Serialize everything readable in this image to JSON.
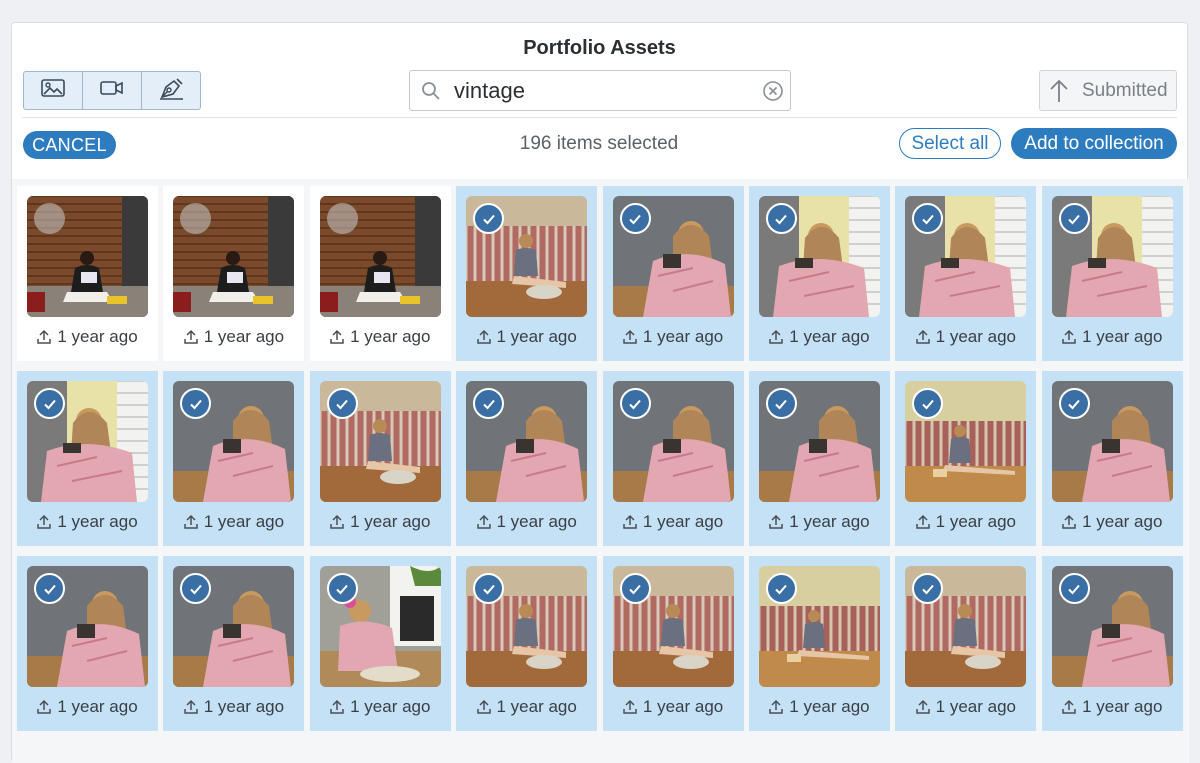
{
  "header": {
    "title": "Portfolio Assets"
  },
  "media_types": [
    {
      "name": "image-icon"
    },
    {
      "name": "video-icon"
    },
    {
      "name": "illustration-icon"
    }
  ],
  "search": {
    "value": "vintage"
  },
  "submitted_label": "Submitted",
  "toolbar": {
    "cancel_label": "CANCEL",
    "selection_count": "196 items selected",
    "select_all_label": "Select all",
    "add_collection_label": "Add to collection"
  },
  "colors": {
    "accent": "#2e7cc0",
    "selected_tile": "#c4e1f6",
    "check": "#3a6fa5"
  },
  "assets": [
    {
      "scene": "wicker",
      "selected": false,
      "uploaded": "1 year ago"
    },
    {
      "scene": "wicker",
      "selected": false,
      "uploaded": "1 year ago"
    },
    {
      "scene": "wicker",
      "selected": false,
      "uploaded": "1 year ago"
    },
    {
      "scene": "sofa",
      "selected": true,
      "uploaded": "1 year ago"
    },
    {
      "scene": "robe-gray",
      "selected": true,
      "uploaded": "1 year ago"
    },
    {
      "scene": "robe-yellow",
      "selected": true,
      "uploaded": "1 year ago"
    },
    {
      "scene": "robe-yellow",
      "selected": true,
      "uploaded": "1 year ago"
    },
    {
      "scene": "robe-yellow",
      "selected": true,
      "uploaded": "1 year ago"
    },
    {
      "scene": "robe-yellow",
      "selected": true,
      "uploaded": "1 year ago"
    },
    {
      "scene": "robe-gray",
      "selected": true,
      "uploaded": "1 year ago"
    },
    {
      "scene": "sofa",
      "selected": true,
      "uploaded": "1 year ago"
    },
    {
      "scene": "robe-gray",
      "selected": true,
      "uploaded": "1 year ago"
    },
    {
      "scene": "robe-gray",
      "selected": true,
      "uploaded": "1 year ago"
    },
    {
      "scene": "robe-gray",
      "selected": true,
      "uploaded": "1 year ago"
    },
    {
      "scene": "sofa-yellow",
      "selected": true,
      "uploaded": "1 year ago"
    },
    {
      "scene": "robe-gray",
      "selected": true,
      "uploaded": "1 year ago"
    },
    {
      "scene": "robe-gray",
      "selected": true,
      "uploaded": "1 year ago"
    },
    {
      "scene": "robe-gray",
      "selected": true,
      "uploaded": "1 year ago"
    },
    {
      "scene": "fireplace",
      "selected": true,
      "uploaded": "1 year ago"
    },
    {
      "scene": "sofa",
      "selected": true,
      "uploaded": "1 year ago"
    },
    {
      "scene": "sofa",
      "selected": true,
      "uploaded": "1 year ago"
    },
    {
      "scene": "sofa-yellow",
      "selected": true,
      "uploaded": "1 year ago"
    },
    {
      "scene": "sofa",
      "selected": true,
      "uploaded": "1 year ago"
    },
    {
      "scene": "robe-gray",
      "selected": true,
      "uploaded": "1 year ago"
    }
  ]
}
